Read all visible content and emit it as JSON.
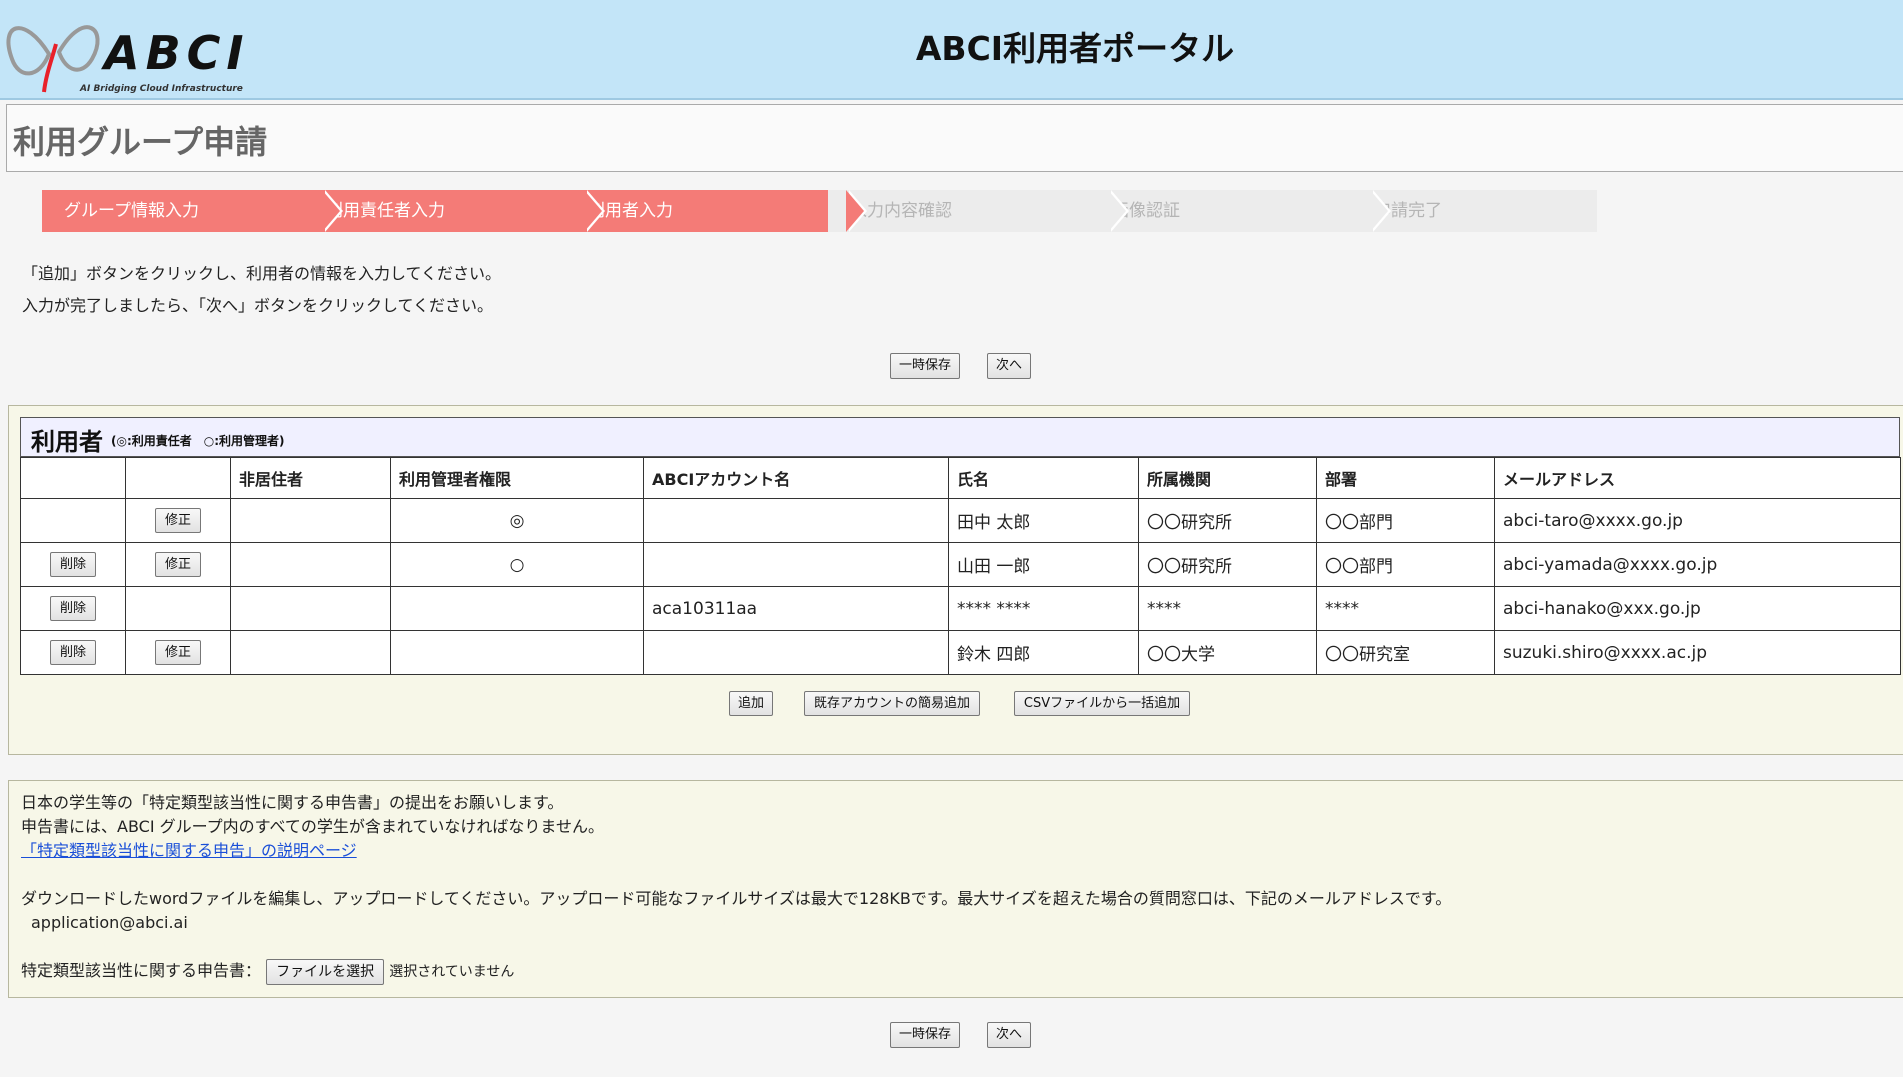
{
  "header": {
    "logo_text": "ABCI",
    "logo_subtitle": "AI Bridging Cloud Infrastructure",
    "title": "ABCI利用者ポータル"
  },
  "page": {
    "title": "利用グループ申請"
  },
  "steps": [
    {
      "label": "グループ情報入力",
      "state": "done"
    },
    {
      "label": "利用責任者入力",
      "state": "done"
    },
    {
      "label": "利用者入力",
      "state": "current"
    },
    {
      "label": "入力内容確認",
      "state": "pending"
    },
    {
      "label": "画像認証",
      "state": "pending"
    },
    {
      "label": "申請完了",
      "state": "pending"
    }
  ],
  "instructions": {
    "line1": "「追加」ボタンをクリックし、利用者の情報を入力してください。",
    "line2": "入力が完了しましたら、「次へ」ボタンをクリックしてください。"
  },
  "actions": {
    "save_label": "一時保存",
    "next_label": "次へ"
  },
  "users": {
    "title": "利用者",
    "legend": "(◎:利用責任者　○:利用管理者)",
    "columns": [
      "",
      "",
      "非居住者",
      "利用管理者権限",
      "ABCIアカウント名",
      "氏名",
      "所属機関",
      "部署",
      "メールアドレス"
    ],
    "delete_label": "削除",
    "edit_label": "修正",
    "rows": [
      {
        "delete": false,
        "edit": true,
        "nonresident": "",
        "admin": "◎",
        "account": "",
        "name": "田中 太郎",
        "org": "〇〇研究所",
        "dept": "〇〇部門",
        "email": "abci-taro@xxxx.go.jp"
      },
      {
        "delete": true,
        "edit": true,
        "nonresident": "",
        "admin": "○",
        "account": "",
        "name": "山田 一郎",
        "org": "〇〇研究所",
        "dept": "〇〇部門",
        "email": "abci-yamada@xxxx.go.jp"
      },
      {
        "delete": true,
        "edit": false,
        "nonresident": "",
        "admin": "",
        "account": "aca10311aa",
        "name": "**** ****",
        "org": "****",
        "dept": "****",
        "email": "abci-hanako@xxx.go.jp"
      },
      {
        "delete": true,
        "edit": true,
        "nonresident": "",
        "admin": "",
        "account": "",
        "name": "鈴木 四郎",
        "org": "〇〇大学",
        "dept": "〇〇研究室",
        "email": "suzuki.shiro@xxxx.ac.jp"
      }
    ],
    "add_label": "追加",
    "add_existing_label": "既存アカウントの簡易追加",
    "add_csv_label": "CSVファイルから一括追加"
  },
  "declaration": {
    "line1": "日本の学生等の「特定類型該当性に関する申告書」の提出をお願いします。",
    "line2": "申告書には、ABCI グループ内のすべての学生が含まれていなければなりません。",
    "link": "「特定類型該当性に関する申告」の説明ページ",
    "line3": "ダウンロードしたwordファイルを編集し、アップロードしてください。アップロード可能なファイルサイズは最大で128KBです。最大サイズを超えた場合の質問窓口は、下記のメールアドレスです。",
    "email": "application@abci.ai",
    "file_label": "特定類型該当性に関する申告書：",
    "file_button": "ファイルを選択",
    "file_status": "選択されていません"
  }
}
